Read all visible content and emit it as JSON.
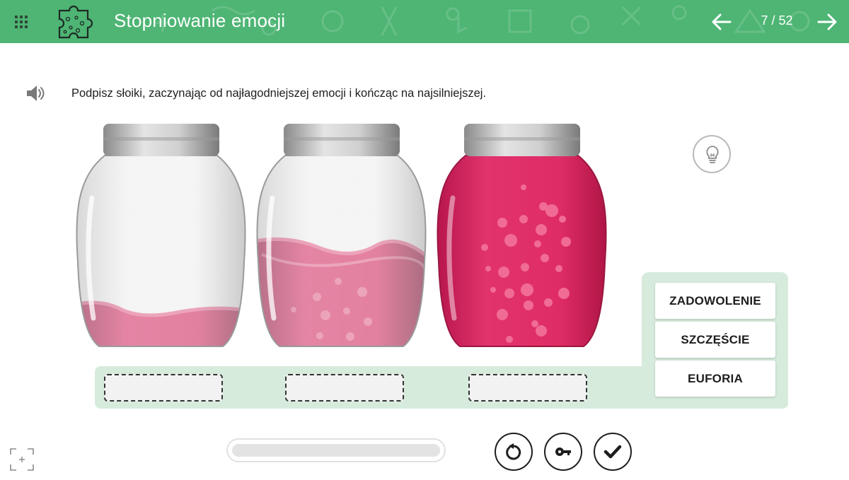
{
  "header": {
    "title": "Stopniowanie emocji",
    "page_counter": "7 / 52",
    "background_color": "#4eb574",
    "icons": {
      "menu": "grid-menu-icon",
      "activity": "puzzle-icon",
      "prev": "arrow-left-icon",
      "next": "arrow-right-icon"
    }
  },
  "instruction": {
    "text": "Podpisz słoiki, zaczynając od najłagodniejszej emocji i kończąc na najsilniejszej.",
    "audio_icon": "speaker-icon"
  },
  "jars": [
    {
      "fill_level": 0.18,
      "color": "#d81e5b"
    },
    {
      "fill_level": 0.55,
      "color": "#d81e5b"
    },
    {
      "fill_level": 1.0,
      "color": "#d81e5b"
    }
  ],
  "drop_slots": [
    "",
    "",
    ""
  ],
  "word_bank": {
    "items": [
      "ZADOWOLENIE",
      "SZCZĘŚCIE",
      "EUFORIA"
    ]
  },
  "controls": {
    "progress": 0,
    "buttons": [
      "restart-icon",
      "key-icon",
      "check-icon"
    ],
    "hint_icon": "lightbulb-icon",
    "fullscreen_icon": "fullscreen-icon"
  },
  "colors": {
    "accent": "#4eb574",
    "strip": "#d6ebdc",
    "jam": "#d81e5b"
  }
}
